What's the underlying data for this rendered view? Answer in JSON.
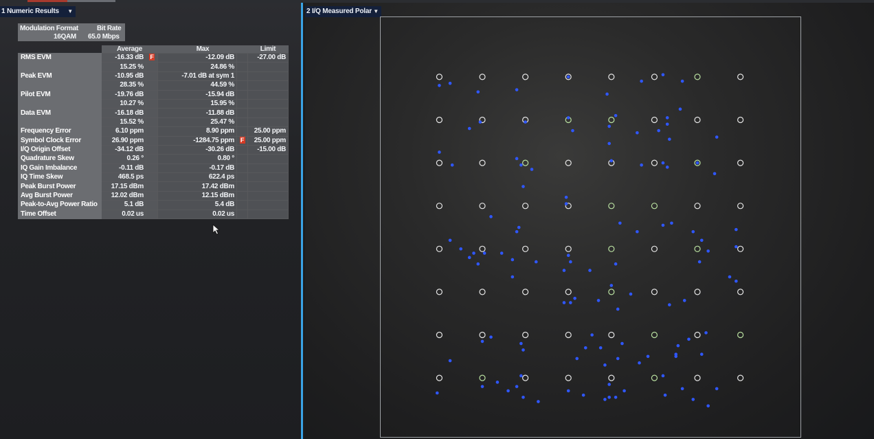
{
  "left_pane": {
    "title": "1 Numeric Results",
    "header": {
      "modulation_label": "Modulation Format",
      "modulation_value": "16QAM",
      "bitrate_label": "Bit Rate",
      "bitrate_value": "65.0 Mbps"
    },
    "columns": {
      "average": "Average",
      "max": "Max",
      "limit": "Limit"
    },
    "rows": [
      {
        "label": "RMS EVM",
        "avg": "-16.33 dB",
        "avg_flag": "F",
        "max": "-12.09 dB",
        "max_flag": "",
        "limit": "-27.00 dB"
      },
      {
        "label": "",
        "avg": "15.25 %",
        "avg_flag": "",
        "max": "24.86 %",
        "max_flag": "",
        "limit": ""
      },
      {
        "label": "Peak EVM",
        "avg": "-10.95 dB",
        "avg_flag": "",
        "max": "-7.01 dB at sym 1",
        "max_flag": "",
        "limit": ""
      },
      {
        "label": "",
        "avg": "28.35 %",
        "avg_flag": "",
        "max": "44.59 %",
        "max_flag": "",
        "limit": ""
      },
      {
        "label": "Pilot EVM",
        "avg": "-19.76 dB",
        "avg_flag": "",
        "max": "-15.94 dB",
        "max_flag": "",
        "limit": ""
      },
      {
        "label": "",
        "avg": "10.27 %",
        "avg_flag": "",
        "max": "15.95 %",
        "max_flag": "",
        "limit": ""
      },
      {
        "label": "Data EVM",
        "avg": "-16.18 dB",
        "avg_flag": "",
        "max": "-11.88 dB",
        "max_flag": "",
        "limit": ""
      },
      {
        "label": "",
        "avg": "15.52 %",
        "avg_flag": "",
        "max": "25.47 %",
        "max_flag": "",
        "limit": ""
      },
      {
        "label": "Frequency Error",
        "avg": "6.10 ppm",
        "avg_flag": "",
        "max": "8.90 ppm",
        "max_flag": "",
        "limit": "25.00 ppm"
      },
      {
        "label": "Symbol Clock Error",
        "avg": "26.90 ppm",
        "avg_flag": "",
        "max": "-1284.75 ppm",
        "max_flag": "F",
        "limit": "25.00 ppm"
      },
      {
        "label": "I/Q Origin Offset",
        "avg": "-34.12 dB",
        "avg_flag": "",
        "max": "-30.26 dB",
        "max_flag": "",
        "limit": "-15.00 dB"
      },
      {
        "label": "Quadrature Skew",
        "avg": "0.26 °",
        "avg_flag": "",
        "max": "0.80 °",
        "max_flag": "",
        "limit": ""
      },
      {
        "label": "IQ Gain Imbalance",
        "avg": "-0.11 dB",
        "avg_flag": "",
        "max": "-0.17 dB",
        "max_flag": "",
        "limit": ""
      },
      {
        "label": "IQ Time Skew",
        "avg": "468.5 ps",
        "avg_flag": "",
        "max": "622.4 ps",
        "max_flag": "",
        "limit": ""
      },
      {
        "label": "Peak Burst Power",
        "avg": "17.15 dBm",
        "avg_flag": "",
        "max": "17.42 dBm",
        "max_flag": "",
        "limit": ""
      },
      {
        "label": "Avg Burst Power",
        "avg": "12.02 dBm",
        "avg_flag": "",
        "max": "12.15 dBm",
        "max_flag": "",
        "limit": ""
      },
      {
        "label": "Peak-to-Avg Power Ratio",
        "avg": "5.1 dB",
        "avg_flag": "",
        "max": "5.4 dB",
        "max_flag": "",
        "limit": ""
      },
      {
        "label": "Time Offset",
        "avg": "0.02 us",
        "avg_flag": "",
        "max": "0.02 us",
        "max_flag": "",
        "limit": ""
      }
    ]
  },
  "right_pane": {
    "title": "2 I/Q Measured Polar"
  },
  "colors": {
    "pane_border_active": "#3aa3e6",
    "reference_point": "#e6e6e6",
    "pilot_point": "#b9e0a0",
    "measured_point": "#2f57ff",
    "fail_flag": "#d63a24"
  },
  "chart_data": {
    "type": "scatter",
    "title": "",
    "xlabel": "",
    "ylabel": "",
    "grid": false,
    "reference_grid": {
      "i_levels": [
        -7,
        -5,
        -3,
        -1,
        1,
        3,
        5,
        7
      ],
      "q_levels": [
        -7,
        -5,
        -3,
        -1,
        1,
        3,
        5,
        7
      ]
    },
    "series": [
      {
        "points": [
          [
            -7.0,
            6.6
          ],
          [
            -6.5,
            6.7
          ],
          [
            -5.2,
            6.3
          ],
          [
            -3.4,
            6.4
          ],
          [
            -1.0,
            7.0
          ],
          [
            0.8,
            6.2
          ],
          [
            2.4,
            6.8
          ],
          [
            3.4,
            7.1
          ],
          [
            4.3,
            6.8
          ],
          [
            -5.6,
            4.6
          ],
          [
            -5.1,
            4.9
          ],
          [
            -3.0,
            4.9
          ],
          [
            -1.0,
            5.1
          ],
          [
            -0.8,
            4.5
          ],
          [
            1.2,
            5.2
          ],
          [
            0.9,
            4.7
          ],
          [
            0.9,
            3.9
          ],
          [
            3.2,
            4.5
          ],
          [
            3.6,
            5.1
          ],
          [
            3.6,
            4.8
          ],
          [
            4.2,
            5.5
          ],
          [
            5.9,
            4.2
          ],
          [
            2.2,
            4.4
          ],
          [
            3.7,
            4.1
          ],
          [
            -7.0,
            3.5
          ],
          [
            -6.4,
            2.9
          ],
          [
            -3.4,
            3.2
          ],
          [
            -3.2,
            2.9
          ],
          [
            -2.7,
            2.7
          ],
          [
            -3.1,
            1.9
          ],
          [
            -1.1,
            1.4
          ],
          [
            -1.1,
            1.1
          ],
          [
            1.0,
            3.1
          ],
          [
            2.4,
            2.9
          ],
          [
            3.4,
            3.0
          ],
          [
            3.6,
            2.8
          ],
          [
            5.0,
            3.0
          ],
          [
            5.8,
            2.5
          ],
          [
            -4.6,
            0.5
          ],
          [
            -3.3,
            0.0
          ],
          [
            -3.4,
            -0.2
          ],
          [
            1.4,
            0.2
          ],
          [
            2.2,
            -0.2
          ],
          [
            3.4,
            0.1
          ],
          [
            3.8,
            0.2
          ],
          [
            4.8,
            -0.2
          ],
          [
            5.2,
            -0.6
          ],
          [
            6.8,
            -0.1
          ],
          [
            -6.5,
            -0.6
          ],
          [
            -6.0,
            -1.0
          ],
          [
            -5.6,
            -1.4
          ],
          [
            -5.4,
            -1.2
          ],
          [
            -5.2,
            -1.7
          ],
          [
            -4.9,
            -1.2
          ],
          [
            -4.1,
            -1.2
          ],
          [
            -3.6,
            -1.5
          ],
          [
            -2.5,
            -1.6
          ],
          [
            -1.0,
            -1.3
          ],
          [
            -0.9,
            -1.6
          ],
          [
            -1.2,
            -2.0
          ],
          [
            1.2,
            -1.7
          ],
          [
            5.1,
            -1.6
          ],
          [
            5.5,
            -1.1
          ],
          [
            6.8,
            -0.9
          ],
          [
            6.5,
            -2.3
          ],
          [
            6.8,
            -2.5
          ],
          [
            -3.6,
            -2.3
          ],
          [
            1.0,
            -2.7
          ],
          [
            0.0,
            -2.0
          ],
          [
            -0.7,
            -3.3
          ],
          [
            -0.9,
            -3.5
          ],
          [
            -1.2,
            -3.5
          ],
          [
            0.4,
            -3.4
          ],
          [
            1.3,
            -3.8
          ],
          [
            3.7,
            -3.6
          ],
          [
            4.4,
            -3.4
          ],
          [
            1.9,
            -3.1
          ],
          [
            5.4,
            -4.9
          ],
          [
            -6.5,
            -6.2
          ],
          [
            -5.0,
            -5.3
          ],
          [
            -4.6,
            -5.1
          ],
          [
            -3.2,
            -5.4
          ],
          [
            -3.1,
            -5.7
          ],
          [
            -0.6,
            -6.1
          ],
          [
            -0.2,
            -5.6
          ],
          [
            0.7,
            -6.4
          ],
          [
            1.3,
            -6.1
          ],
          [
            1.5,
            -5.4
          ],
          [
            2.7,
            -6.0
          ],
          [
            2.3,
            -6.3
          ],
          [
            4.0,
            -6.0
          ],
          [
            4.0,
            -5.9
          ],
          [
            5.2,
            -5.9
          ],
          [
            4.6,
            -5.2
          ],
          [
            3.4,
            -6.9
          ],
          [
            4.1,
            -5.5
          ],
          [
            0.1,
            -5.0
          ],
          [
            0.5,
            -5.6
          ],
          [
            -7.1,
            -7.7
          ],
          [
            -5.0,
            -7.4
          ],
          [
            -4.3,
            -7.2
          ],
          [
            -3.8,
            -7.6
          ],
          [
            -3.4,
            -7.4
          ],
          [
            -3.2,
            -6.9
          ],
          [
            -3.1,
            -7.9
          ],
          [
            -2.4,
            -8.1
          ],
          [
            -1.0,
            -7.6
          ],
          [
            -0.3,
            -7.8
          ],
          [
            0.7,
            -8.0
          ],
          [
            1.2,
            -7.9
          ],
          [
            1.6,
            -7.6
          ],
          [
            3.5,
            -7.8
          ],
          [
            4.3,
            -7.5
          ],
          [
            4.8,
            -8.0
          ],
          [
            5.9,
            -7.5
          ],
          [
            5.5,
            -8.3
          ],
          [
            0.9,
            -7.3
          ],
          [
            0.9,
            -7.9
          ]
        ]
      }
    ]
  }
}
